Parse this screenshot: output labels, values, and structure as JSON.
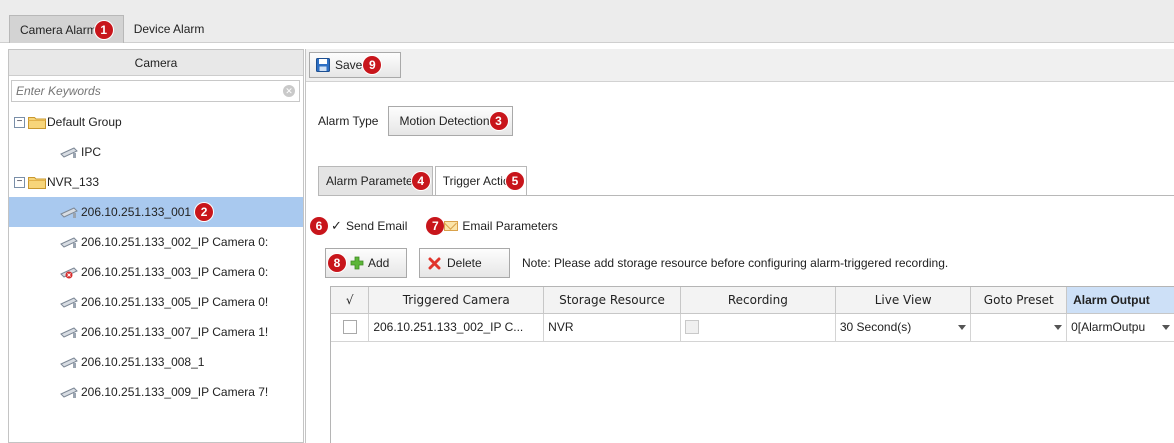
{
  "top_tabs": [
    {
      "label": "Camera Alarm",
      "badge": "1"
    },
    {
      "label": "Device Alarm"
    }
  ],
  "camera_panel": {
    "title": "Camera",
    "search_placeholder": "Enter Keywords",
    "tree": [
      {
        "label": "Default Group",
        "type": "group",
        "expander": "−"
      },
      {
        "label": "IPC",
        "type": "camera"
      },
      {
        "label": "NVR_133",
        "type": "group",
        "expander": "−"
      },
      {
        "label": "206.10.251.133_001",
        "type": "camera",
        "selected": true,
        "badge": "2"
      },
      {
        "label": "206.10.251.133_002_IP Camera 0:",
        "type": "camera"
      },
      {
        "label": "206.10.251.133_003_IP Camera 0:",
        "type": "camera",
        "offline": true
      },
      {
        "label": "206.10.251.133_005_IP Camera 0!",
        "type": "camera"
      },
      {
        "label": "206.10.251.133_007_IP Camera 1!",
        "type": "camera"
      },
      {
        "label": "206.10.251.133_008_1",
        "type": "camera"
      },
      {
        "label": "206.10.251.133_009_IP Camera 7!",
        "type": "camera"
      }
    ]
  },
  "toolbar": {
    "save_label": "Save",
    "save_badge": "9"
  },
  "alarm_type": {
    "label": "Alarm Type",
    "value": "Motion Detection",
    "badge": "3"
  },
  "sub_tabs": [
    {
      "label": "Alarm Paramete",
      "badge": "4"
    },
    {
      "label": "Trigger Actic",
      "badge": "5",
      "active": true
    }
  ],
  "email": {
    "send_label": "Send Email",
    "send_checked": "✓",
    "send_badge": "6",
    "params_label": "Email Parameters",
    "params_badge": "7"
  },
  "actions": {
    "add_label": "Add",
    "add_badge": "8",
    "delete_label": "Delete",
    "note": "Note: Please add storage resource before configuring alarm-triggered recording."
  },
  "table": {
    "columns": [
      "√",
      "Triggered Camera",
      "Storage Resource",
      "Recording",
      "Live View",
      "Goto Preset",
      "Alarm Output"
    ],
    "rows": [
      {
        "camera": "206.10.251.133_002_IP C...",
        "storage": "NVR",
        "live_view": "30 Second(s)",
        "goto_preset": "",
        "alarm_output": "0[AlarmOutpu"
      }
    ]
  },
  "colors": {
    "badge": "#c8151b",
    "selection": "#a9c9ef",
    "header_highlight": "#cde0f7"
  }
}
